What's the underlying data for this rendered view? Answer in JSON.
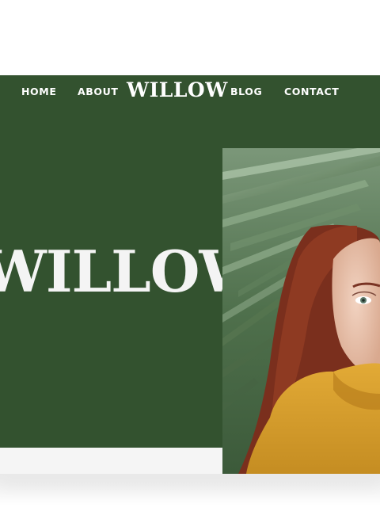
{
  "nav": {
    "items": [
      {
        "label": "HOME"
      },
      {
        "label": "ABOUT"
      },
      {
        "label": "BLOG"
      },
      {
        "label": "CONTACT"
      }
    ],
    "logo": "WILLOW"
  },
  "hero": {
    "title": "WILLOW",
    "photo_icon": "portrait-photo"
  },
  "colors": {
    "brand_green": "#33522f",
    "text": "#ffffff",
    "strip": "#f5f5f5",
    "jacket": "#d39a2a",
    "hair": "#7a2f1d"
  }
}
